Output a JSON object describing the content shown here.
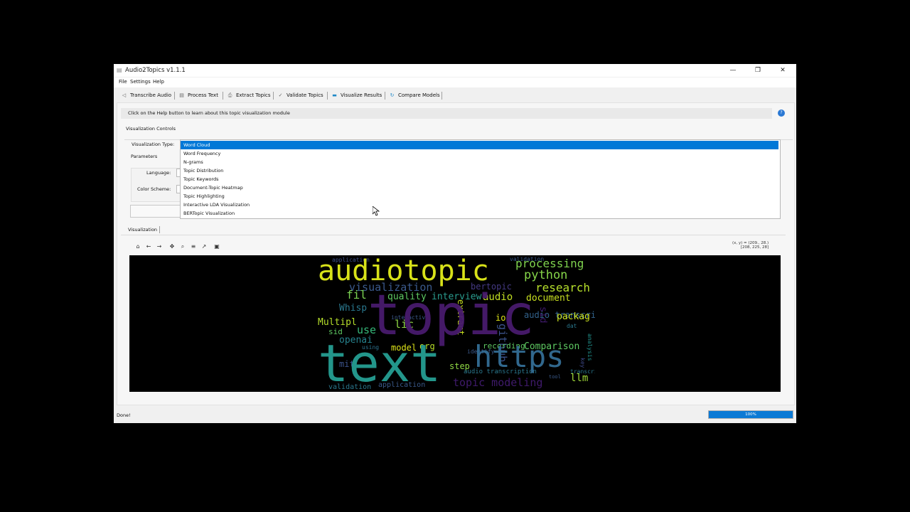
{
  "window": {
    "title": "Audio2Topics v1.1.1"
  },
  "titlebar": {
    "minimize_glyph": "—",
    "restore_glyph": "❐",
    "close_glyph": "✕"
  },
  "menu": {
    "items": [
      "File",
      "Settings",
      "Help"
    ]
  },
  "tabs": [
    {
      "label": "Transcribe Audio",
      "icon": "speaker-icon"
    },
    {
      "label": "Process Text",
      "icon": "document-icon"
    },
    {
      "label": "Extract Topics",
      "icon": "extract-icon"
    },
    {
      "label": "Validate Topics",
      "icon": "check-icon"
    },
    {
      "label": "Visualize Results",
      "icon": "monitor-icon"
    },
    {
      "label": "Compare Models",
      "icon": "refresh-icon"
    }
  ],
  "help_text": "Click on the Help button to learn about this topic visualization module",
  "help_button": {
    "glyph": "?",
    "color": "#2b79d4"
  },
  "controls": {
    "section_label": "Visualization Controls",
    "type_label": "Visualization Type:",
    "parameters_label": "Parameters",
    "language_label": "Language:",
    "color_scheme_label": "Color Scheme:",
    "options": [
      "Word Cloud",
      "Word Frequency",
      "N-grams",
      "Topic Distribution",
      "Topic Keywords",
      "Document-Topic Heatmap",
      "Topic Highlighting",
      "Interactive LDA Visualization",
      "BERTopic Visualization"
    ],
    "selected_option": "Word Cloud",
    "selected_color": "#0078d7"
  },
  "visualization": {
    "tab_label": "Visualization",
    "toolbar_icons": [
      "home-icon",
      "back-icon",
      "forward-icon",
      "pan-icon",
      "zoom-icon",
      "configure-icon",
      "edit-axis-icon",
      "save-icon"
    ],
    "coords_line1": "(x, y) = (209., 28.)",
    "coords_line2": "[208, 225, 28]"
  },
  "wordcloud": {
    "background": "#000000",
    "words": [
      "topic",
      "text",
      "audiotopic",
      "https",
      "processing",
      "python",
      "research",
      "visualization",
      "quality",
      "interview",
      "audio",
      "document",
      "Whisp",
      "fil",
      "bertopic",
      "Multipl",
      "use",
      "lic",
      "openai",
      "extract",
      "io",
      "packag",
      "model",
      "org",
      "Comparison",
      "recording",
      "step",
      "mit",
      "topic modeling",
      "llm",
      "application",
      "validation",
      "audio transcription",
      "sid",
      "github",
      "transcribed",
      "dat",
      "analysis",
      "key",
      "using",
      "identify",
      "interactiv",
      "tool",
      "spacy",
      "svg",
      "format",
      "optional"
    ]
  },
  "status": {
    "text": "Done!",
    "progress_label": "100%",
    "progress": 1.0,
    "progress_color": "#0c7ad5"
  }
}
